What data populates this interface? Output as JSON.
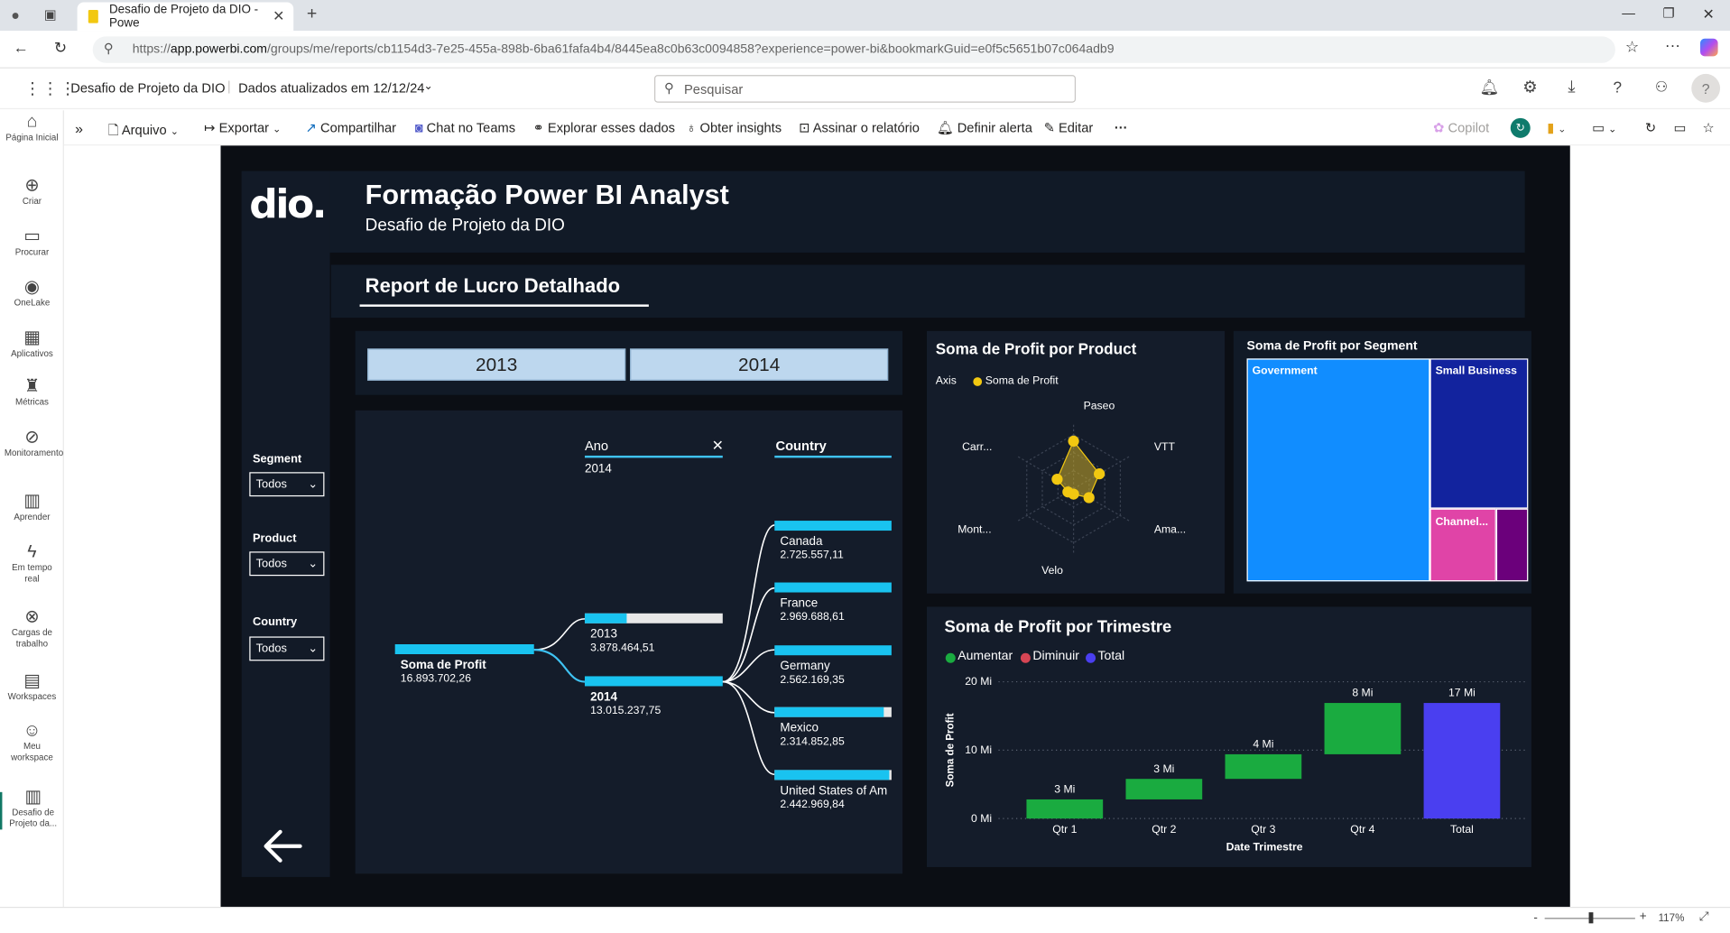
{
  "browser": {
    "tab_title": "Desafio de Projeto da DIO - Powe",
    "url_prefix": "https://",
    "url_host": "app.powerbi.com",
    "url_path": "/groups/me/reports/cb1154d3-7e25-455a-898b-6ba61fafa4b4/8445ea8c0b63c0094858?experience=power-bi&bookmarkGuid=e0f5c5651b07c064adb9"
  },
  "header": {
    "report_name": "Desafio de Projeto da DIO",
    "updated": "Dados atualizados em 12/12/24",
    "search_placeholder": "Pesquisar",
    "avatar_initial": "?"
  },
  "toolbar": {
    "arquivo": "Arquivo",
    "exportar": "Exportar",
    "compartilhar": "Compartilhar",
    "chat_teams": "Chat no Teams",
    "explorar": "Explorar esses dados",
    "insights": "Obter insights",
    "assinar": "Assinar o relatório",
    "alerta": "Definir alerta",
    "editar": "Editar",
    "more": "···",
    "copilot": "Copilot"
  },
  "leftnav": [
    {
      "label": "Página Inicial",
      "icon": "home-icon"
    },
    {
      "label": "Criar",
      "icon": "plus-circle-icon"
    },
    {
      "label": "Procurar",
      "icon": "folder-icon"
    },
    {
      "label": "OneLake",
      "icon": "onelake-icon"
    },
    {
      "label": "Aplicativos",
      "icon": "apps-icon"
    },
    {
      "label": "Métricas",
      "icon": "trophy-icon"
    },
    {
      "label": "Monitoramento",
      "icon": "monitor-icon"
    },
    {
      "label": "Aprender",
      "icon": "book-icon"
    },
    {
      "label": "Em tempo real",
      "icon": "lightning-icon"
    },
    {
      "label": "Cargas de trabalho",
      "icon": "workloads-icon"
    },
    {
      "label": "Workspaces",
      "icon": "workspaces-icon"
    },
    {
      "label": "Meu workspace",
      "icon": "user-icon"
    },
    {
      "label": "Desafio de Projeto da...",
      "icon": "report-icon"
    }
  ],
  "report": {
    "logo_text": "dio.",
    "title": "Formação Power BI Analyst",
    "subtitle": "Desafio de Projeto da DIO",
    "page_title": "Report de Lucro Detalhado",
    "slicers": {
      "segment_label": "Segment",
      "segment_value": "Todos",
      "product_label": "Product",
      "product_value": "Todos",
      "country_label": "Country",
      "country_value": "Todos"
    },
    "year_buttons": [
      "2013",
      "2014"
    ],
    "back_arrow": "back-arrow-icon"
  },
  "decomposition": {
    "level1_header": "Ano",
    "level1_filter": "2014",
    "level2_header": "Country",
    "root_label": "Soma de Profit",
    "root_value": "16.893.702,26",
    "root_fraction": 1.0,
    "years": [
      {
        "label": "2013",
        "value": "3.878.464,51",
        "fraction": 0.3
      },
      {
        "label": "2014",
        "value": "13.015.237,75",
        "fraction": 1.0
      }
    ],
    "countries": [
      {
        "label": "Canada",
        "value": "2.725.557,11",
        "fraction": 1.0
      },
      {
        "label": "France",
        "value": "2.969.688,61",
        "fraction": 1.0
      },
      {
        "label": "Germany",
        "value": "2.562.169,35",
        "fraction": 1.0
      },
      {
        "label": "Mexico",
        "value": "2.314.852,85",
        "fraction": 0.93
      },
      {
        "label": "United States of Am",
        "value": "2.442.969,84",
        "fraction": 0.98
      }
    ]
  },
  "radar": {
    "title": "Soma de Profit por Product",
    "legend_axis": "Axis",
    "legend_series": "Soma de Profit",
    "axes": [
      "Paseo",
      "VTT",
      "Ama...",
      "Velo",
      "Mont...",
      "Carr..."
    ],
    "values": [
      0.88,
      0.55,
      0.33,
      0.1,
      0.12,
      0.35
    ],
    "color": "#f2c811"
  },
  "treemap": {
    "title": "Soma de Profit por Segment",
    "items": [
      {
        "label": "Government",
        "color": "#118dff"
      },
      {
        "label": "Small Business",
        "color": "#12239e"
      },
      {
        "label": "Channel...",
        "color": "#e044a7"
      },
      {
        "label": "",
        "color": "#6b007b"
      }
    ]
  },
  "chart_data": {
    "type": "bar",
    "title": "Soma de Profit por Trimestre",
    "xlabel": "Date Trimestre",
    "ylabel": "Soma de Profit",
    "legend": [
      "Aumentar",
      "Diminuir",
      "Total"
    ],
    "legend_colors": [
      "#1aab40",
      "#d64554",
      "#4a3ff0"
    ],
    "categories": [
      "Qtr 1",
      "Qtr 2",
      "Qtr 3",
      "Qtr 4",
      "Total"
    ],
    "data_labels": [
      "3 Mi",
      "3 Mi",
      "4 Mi",
      "8 Mi",
      "17 Mi"
    ],
    "start": [
      0,
      2.8,
      5.8,
      9.4,
      0
    ],
    "end": [
      2.8,
      5.8,
      9.4,
      16.9,
      16.9
    ],
    "kind": [
      "increase",
      "increase",
      "increase",
      "increase",
      "total"
    ],
    "yticks": [
      "20 Mi",
      "10 Mi",
      "0 Mi"
    ],
    "ylim": [
      0,
      20
    ],
    "grid": true
  },
  "status": {
    "zoom": "117%"
  }
}
